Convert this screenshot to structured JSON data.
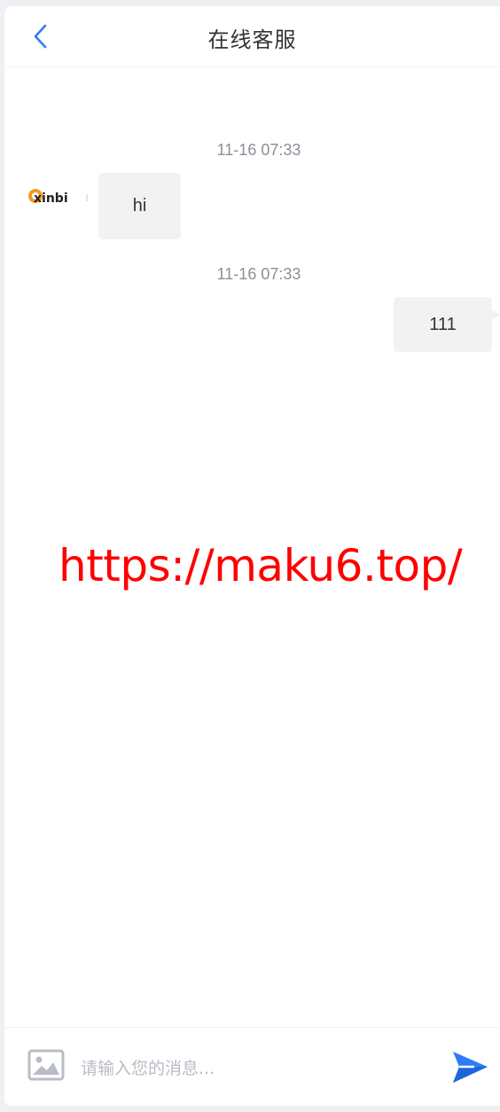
{
  "header": {
    "back_icon": "chevron-left-icon",
    "title": "在线客服"
  },
  "messages": [
    {
      "time": "11-16 07:33",
      "side": "left",
      "text": "hi",
      "avatar_text": "xinbi"
    },
    {
      "time": "11-16 07:33",
      "side": "right",
      "text": "111"
    }
  ],
  "watermark": "https://maku6.top/",
  "footer": {
    "image_icon": "image-icon",
    "input_placeholder": "请输入您的消息...",
    "input_value": "",
    "send_icon": "send-icon"
  },
  "colors": {
    "accent": "#2e7df6",
    "bubble": "#f2f2f2",
    "watermark": "#ff0000",
    "time_text": "#8c8f99",
    "logo_orange": "#f39a1e"
  }
}
